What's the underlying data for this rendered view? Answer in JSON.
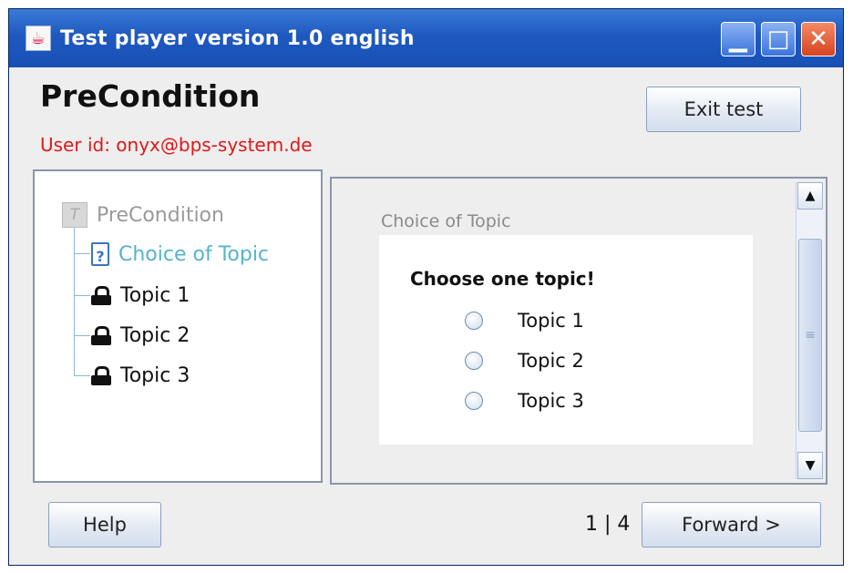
{
  "window": {
    "title": "Test player version 1.0 english",
    "app_icon": "java-cup-icon",
    "controls": {
      "minimize": "minimize-icon",
      "maximize": "maximize-icon",
      "close": "close-icon"
    }
  },
  "header": {
    "title": "PreCondition",
    "user": "User id: onyx@bps-system.de",
    "exit_label": "Exit test"
  },
  "tree": {
    "root": {
      "label": "PreCondition",
      "icon": "test-icon"
    },
    "items": [
      {
        "label": "Choice of Topic",
        "icon": "document-question-icon",
        "state": "active"
      },
      {
        "label": "Topic 1",
        "icon": "lock-icon",
        "state": "locked"
      },
      {
        "label": "Topic 2",
        "icon": "lock-icon",
        "state": "locked"
      },
      {
        "label": "Topic 3",
        "icon": "lock-icon",
        "state": "locked"
      }
    ]
  },
  "content": {
    "section_label": "Choice of Topic",
    "question": "Choose one topic!",
    "options": [
      "Topic 1",
      "Topic 2",
      "Topic 3"
    ]
  },
  "footer": {
    "help_label": "Help",
    "page_indicator": "1 | 4",
    "forward_label": "Forward >"
  },
  "colors": {
    "titlebar": "#1f59c0",
    "user_text": "#e01818",
    "active_item": "#55b3cc"
  }
}
